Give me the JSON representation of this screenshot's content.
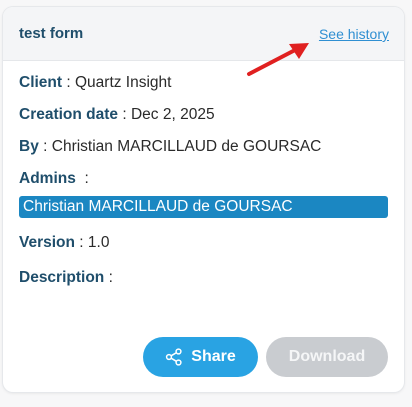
{
  "form": {
    "title": "test form",
    "history_link": "See history"
  },
  "details": {
    "client_label": "Client",
    "client_value": "Quartz Insight",
    "creation_label": "Creation date",
    "creation_value": "Dec 2, 2025",
    "by_label": "By",
    "by_value": "Christian MARCILLAUD de GOURSAC",
    "admins_label": "Admins",
    "admins": [
      "Christian MARCILLAUD de GOURSAC"
    ],
    "version_label": "Version",
    "version_value": "1.0",
    "description_label": "Description",
    "description_value": ""
  },
  "actions": {
    "share_label": "Share",
    "download_label": "Download"
  },
  "icons": {
    "share": "share-icon",
    "annotation": "red-arrow-icon"
  },
  "colors": {
    "title": "#1f4e6b",
    "link": "#2f8fd2",
    "admin_badge": "#1b87c2",
    "share_button": "#29a3e3",
    "download_button_disabled": "#c9ccd0",
    "annotation_arrow": "#e02020"
  }
}
